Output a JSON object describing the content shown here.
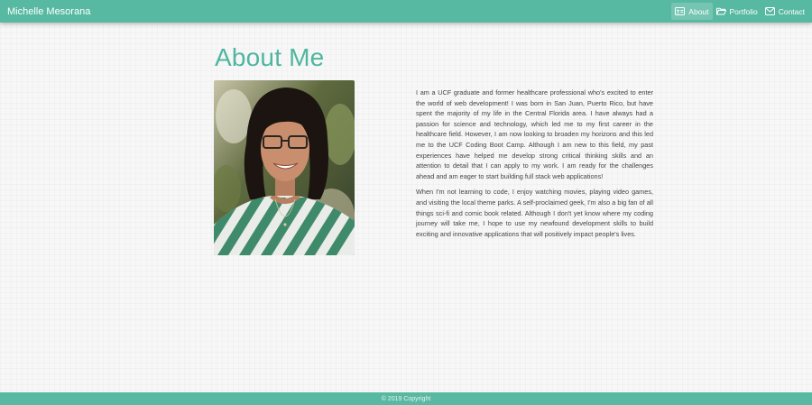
{
  "navbar": {
    "brand": "Michelle Mesorana",
    "links": [
      {
        "label": "About",
        "icon": "id-card-icon",
        "active": true
      },
      {
        "label": "Portfolio",
        "icon": "folder-icon",
        "active": false
      },
      {
        "label": "Contact",
        "icon": "envelope-icon",
        "active": false
      }
    ]
  },
  "main": {
    "heading": "About Me",
    "bio_paragraphs": [
      "I am a UCF graduate and former healthcare professional who's excited to enter the world of web development! I was born in San Juan, Puerto Rico, but have spent the majority of my life in the Central Florida area. I have always had a passion for science and technology, which led me to my first career in the healthcare field. However, I am now looking to broaden my horizons and this led me to the UCF Coding Boot Camp. Although I am new to this field, my past experiences have helped me develop strong critical thinking skills and an attention to detail that I can apply to my work. I am ready for the challenges ahead and am eager to start building full stack web applications!",
      "When I'm not learning to code, I enjoy watching movies, playing video games, and visiting the local theme parks. A self-proclaimed geek, I'm also a big fan of all things sci-fi and comic book related. Although I don't yet know where my coding journey will take me, I hope to use my newfound development skills to build exciting and innovative applications that will positively impact people's lives."
    ]
  },
  "footer": {
    "copyright": "© 2019 Copyright"
  },
  "colors": {
    "accent": "#57b9a1",
    "heading": "#4fb6a0"
  }
}
